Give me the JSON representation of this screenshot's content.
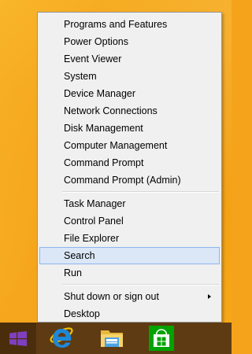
{
  "menu": {
    "group1": [
      {
        "label": "Programs and Features"
      },
      {
        "label": "Power Options"
      },
      {
        "label": "Event Viewer"
      },
      {
        "label": "System"
      },
      {
        "label": "Device Manager"
      },
      {
        "label": "Network Connections"
      },
      {
        "label": "Disk Management"
      },
      {
        "label": "Computer Management"
      },
      {
        "label": "Command Prompt"
      },
      {
        "label": "Command Prompt (Admin)"
      }
    ],
    "group2": [
      {
        "label": "Task Manager"
      },
      {
        "label": "Control Panel"
      },
      {
        "label": "File Explorer"
      },
      {
        "label": "Search",
        "highlighted": true
      },
      {
        "label": "Run"
      }
    ],
    "group3": [
      {
        "label": "Shut down or sign out",
        "has_submenu": true
      },
      {
        "label": "Desktop"
      }
    ]
  },
  "taskbar": {
    "start_button": {
      "icon": "windows-logo-icon",
      "color": "#7f3fbf"
    },
    "pinned": [
      {
        "icon": "internet-explorer-icon"
      },
      {
        "icon": "file-explorer-icon"
      },
      {
        "icon": "windows-store-icon"
      }
    ]
  },
  "colors": {
    "desktop": "#f5a31a",
    "taskbar": "#5e3b12",
    "menu_background": "#f0f0f0",
    "highlight_fill": "#dbe7f7",
    "highlight_border": "#8eb5ea"
  }
}
